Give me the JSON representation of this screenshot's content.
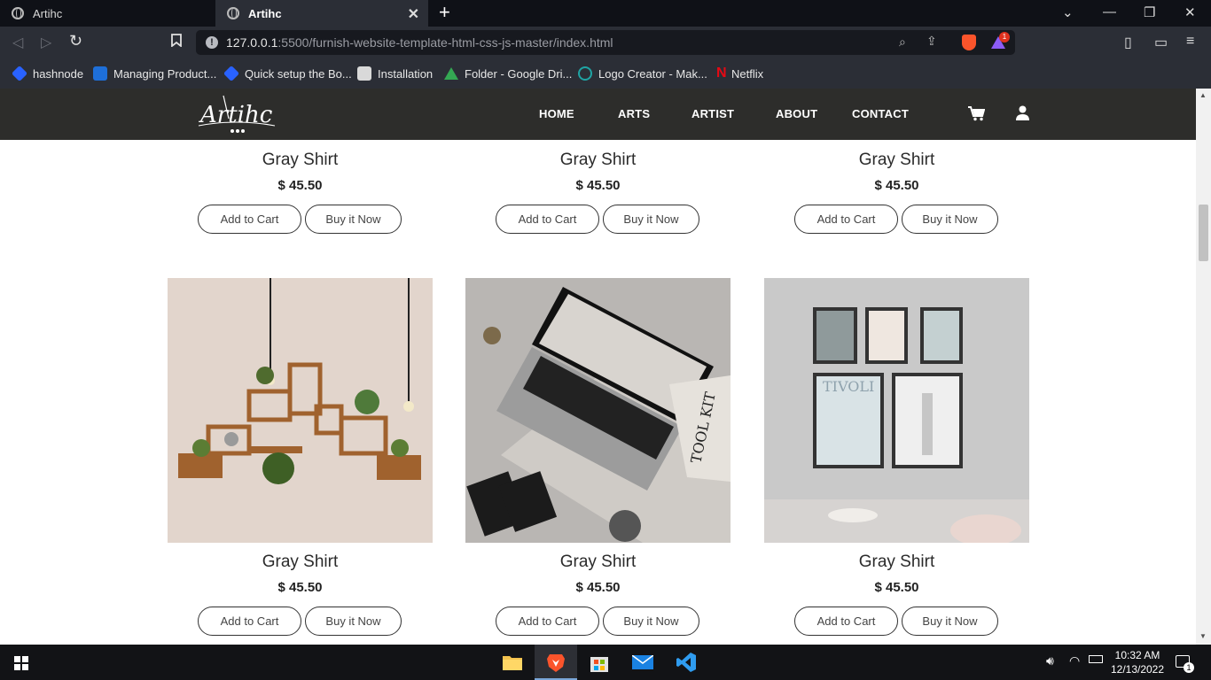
{
  "browser": {
    "tabs": [
      {
        "title": "Artihc",
        "active": false
      },
      {
        "title": "Artihc",
        "active": true
      }
    ],
    "url": {
      "host": "127.0.0.1",
      "rest": ":5500/furnish-website-template-html-css-js-master/index.html"
    },
    "bookmarks": [
      {
        "label": "hashnode",
        "icon": "hashnode-icon",
        "color": "#2962ff"
      },
      {
        "label": "Managing Product...",
        "icon": "managing-product-icon",
        "color": "#1e6fd9"
      },
      {
        "label": "Quick setup the Bo...",
        "icon": "quick-setup-icon",
        "color": "#2962ff"
      },
      {
        "label": "Installation",
        "icon": "installation-icon",
        "color": "#d9d9d9"
      },
      {
        "label": "Folder - Google Dri...",
        "icon": "google-drive-icon",
        "color": "#34a853"
      },
      {
        "label": "Logo Creator - Mak...",
        "icon": "logo-creator-icon",
        "color": "#1fa4a4"
      },
      {
        "label": "Netflix",
        "icon": "netflix-icon",
        "color": "#e50914"
      }
    ],
    "brave_notifications": "1"
  },
  "site": {
    "logo_text": "Artihc",
    "nav": [
      "HOME",
      "ARTS",
      "ARTIST",
      "ABOUT",
      "CONTACT"
    ]
  },
  "products": [
    {
      "title": "Gray Shirt",
      "price": "$ 45.50",
      "add_label": "Add to Cart",
      "buy_label": "Buy it Now"
    },
    {
      "title": "Gray Shirt",
      "price": "$ 45.50",
      "add_label": "Add to Cart",
      "buy_label": "Buy it Now"
    },
    {
      "title": "Gray Shirt",
      "price": "$ 45.50",
      "add_label": "Add to Cart",
      "buy_label": "Buy it Now"
    },
    {
      "title": "Gray Shirt",
      "price": "$ 45.50",
      "add_label": "Add to Cart",
      "buy_label": "Buy it Now",
      "image": "wall-shelves-plants"
    },
    {
      "title": "Gray Shirt",
      "price": "$ 45.50",
      "add_label": "Add to Cart",
      "buy_label": "Buy it Now",
      "image": "laptop-tool-kit"
    },
    {
      "title": "Gray Shirt",
      "price": "$ 45.50",
      "add_label": "Add to Cart",
      "buy_label": "Buy it Now",
      "image": "framed-posters-wall"
    }
  ],
  "taskbar": {
    "time": "10:32 AM",
    "date": "12/13/2022",
    "notification_count": "1"
  },
  "colors": {
    "header_bg": "#2d2d2b",
    "chrome_bg": "#2b2e36",
    "tab_bg": "#0f1117"
  }
}
